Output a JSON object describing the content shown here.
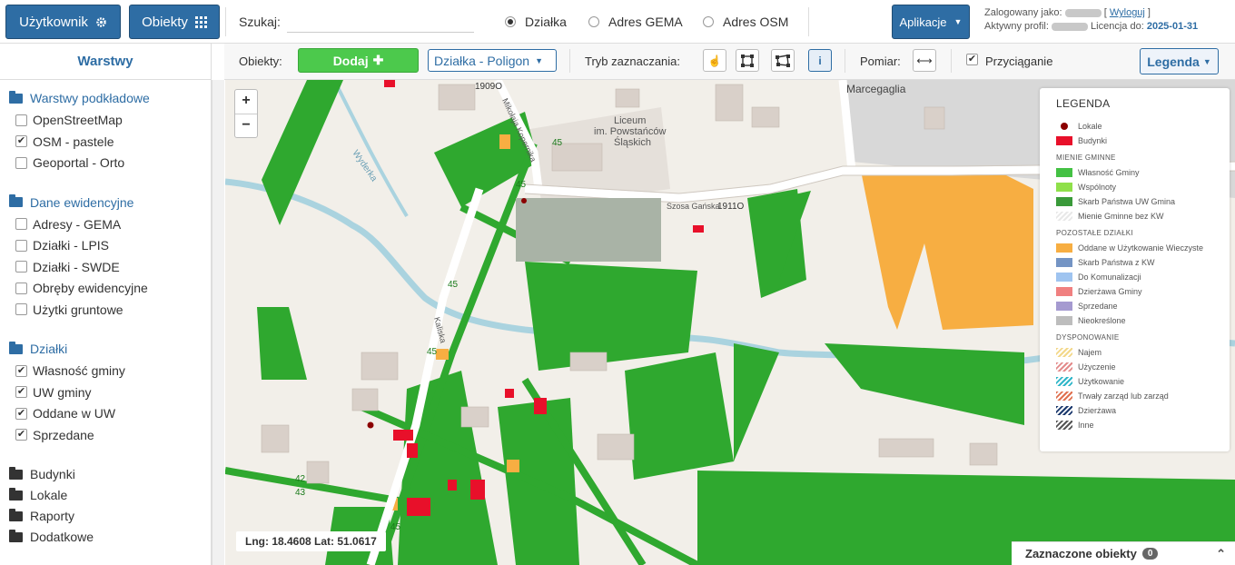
{
  "header": {
    "user_button": "Użytkownik",
    "objects_button": "Obiekty",
    "search_label": "Szukaj:",
    "search_value": "",
    "radios": [
      {
        "label": "Działka",
        "selected": true
      },
      {
        "label": "Adres GEMA",
        "selected": false
      },
      {
        "label": "Adres OSM",
        "selected": false
      }
    ],
    "apps_button": "Aplikacje",
    "logged_as_label": "Zalogowany jako:",
    "logout_link": "Wyloguj",
    "profile_label": "Aktywny profil:",
    "license_label": "Licencja do:",
    "license_date": "2025-01-31"
  },
  "sidebar": {
    "title": "Warstwy",
    "groups": [
      {
        "label": "Warstwy podkładowe",
        "items": [
          {
            "label": "OpenStreetMap",
            "checked": false
          },
          {
            "label": "OSM - pastele",
            "checked": true
          },
          {
            "label": "Geoportal - Orto",
            "checked": false
          }
        ]
      },
      {
        "label": "Dane ewidencyjne",
        "items": [
          {
            "label": "Adresy - GEMA",
            "checked": false
          },
          {
            "label": "Działki - LPIS",
            "checked": false
          },
          {
            "label": "Działki - SWDE",
            "checked": false
          },
          {
            "label": "Obręby ewidencyjne",
            "checked": false
          },
          {
            "label": "Użytki gruntowe",
            "checked": false
          }
        ]
      },
      {
        "label": "Działki",
        "items": [
          {
            "label": "Własność gminy",
            "checked": true
          },
          {
            "label": "UW gminy",
            "checked": true
          },
          {
            "label": "Oddane w UW",
            "checked": true
          },
          {
            "label": "Sprzedane",
            "checked": true
          }
        ]
      }
    ],
    "folders": [
      "Budynki",
      "Lokale",
      "Raporty",
      "Dodatkowe"
    ]
  },
  "toolbar": {
    "objects_label": "Obiekty:",
    "add_button": "Dodaj",
    "layer_select": "Działka - Poligon",
    "selection_mode_label": "Tryb zaznaczania:",
    "measure_label": "Pomiar:",
    "snap_label": "Przyciąganie",
    "snap_checked": true,
    "legend_button": "Legenda",
    "info_icon_label": "i"
  },
  "map": {
    "zoom_in": "+",
    "zoom_out": "−",
    "coords": "Lng: 18.4608 Lat: 51.0617",
    "labels": {
      "school1": "Liceum",
      "school2": "im. Powstańców",
      "school3": "Śląskich",
      "town": "Marcegaglia",
      "road1": "1909O",
      "road2": "1911O",
      "street1": "Szosa Gańska",
      "street2": "Mikołaja Kopernika",
      "street3": "Kaliska",
      "river": "Wyderka",
      "route1": "45",
      "route2": "45",
      "route3": "45",
      "route4": "45",
      "route5": "42",
      "route6": "43",
      "route7": "45"
    },
    "colors": {
      "bg": "#f2efe9",
      "green": "#2fa82f",
      "road": "#ffffff",
      "water": "#aad3df",
      "build": "#d9d0c9",
      "orange": "#f7ae42",
      "red": "#e8102a",
      "gray": "#bdbdbd"
    }
  },
  "legend": {
    "title": "LEGENDA",
    "top": [
      {
        "label": "Lokale",
        "color": "#8b0000",
        "dot": true
      },
      {
        "label": "Budynki",
        "color": "#e8102a"
      }
    ],
    "sections": [
      {
        "title": "Mienie Gminne",
        "rows": [
          {
            "label": "Własność Gminy",
            "color": "#44c144"
          },
          {
            "label": "Wspólnoty",
            "color": "#8fe04a"
          },
          {
            "label": "Skarb Państwa UW Gmina",
            "color": "#3a9a3a"
          },
          {
            "label": "Mienie Gminne bez KW",
            "color": "#e8e8e8",
            "hatch": true
          }
        ]
      },
      {
        "title": "Pozostałe działki",
        "rows": [
          {
            "label": "Oddane w Użytkowanie Wieczyste",
            "color": "#f7ae42"
          },
          {
            "label": "Skarb Państwa z KW",
            "color": "#7494c4"
          },
          {
            "label": "Do Komunalizacji",
            "color": "#9fc4f0"
          },
          {
            "label": "Dzierżawa Gminy",
            "color": "#f08080"
          },
          {
            "label": "Sprzedane",
            "color": "#a59ad0"
          },
          {
            "label": "Nieokreślone",
            "color": "#bdbdbd"
          }
        ]
      },
      {
        "title": "Dysponowanie",
        "rows": [
          {
            "label": "Najem",
            "color": "#f3d88a",
            "hatch": true
          },
          {
            "label": "Użyczenie",
            "color": "#e38b8b",
            "hatch": true
          },
          {
            "label": "Użytkowanie",
            "color": "#2fb6c8",
            "hatch": true
          },
          {
            "label": "Trwały zarząd lub zarząd",
            "color": "#e0704f",
            "hatch": true
          },
          {
            "label": "Dzierżawa",
            "color": "#1c3a6e",
            "hatch": true
          },
          {
            "label": "Inne",
            "color": "#555555",
            "hatch": true
          }
        ]
      }
    ]
  },
  "selected_panel": {
    "label": "Zaznaczone obiekty",
    "count": "0"
  }
}
